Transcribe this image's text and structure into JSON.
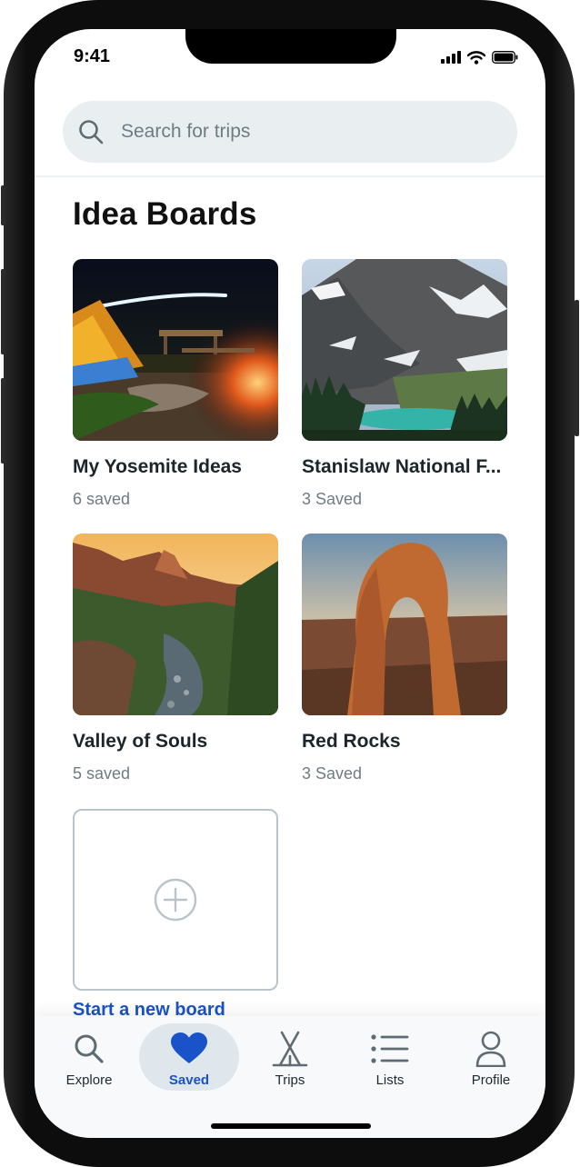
{
  "status_bar": {
    "time": "9:41"
  },
  "search": {
    "placeholder": "Search for trips"
  },
  "page_title": "Idea Boards",
  "boards": [
    {
      "name": "My Yosemite Ideas",
      "count": "6 saved",
      "image": "night-campsite-photo"
    },
    {
      "name": "Stanislaw National F...",
      "count": "3 Saved",
      "image": "mountain-lake-photo"
    },
    {
      "name": "Valley of Souls",
      "count": "5 saved",
      "image": "canyon-river-photo"
    },
    {
      "name": "Red Rocks",
      "count": "3 Saved",
      "image": "sandstone-arch-photo"
    }
  ],
  "new_board": {
    "label": "Start a new board",
    "icon": "plus-circle-icon"
  },
  "tabs": [
    {
      "label": "Explore",
      "icon": "search-icon",
      "active": false
    },
    {
      "label": "Saved",
      "icon": "heart-icon",
      "active": true
    },
    {
      "label": "Trips",
      "icon": "tent-icon",
      "active": false
    },
    {
      "label": "Lists",
      "icon": "list-icon",
      "active": false
    },
    {
      "label": "Profile",
      "icon": "person-icon",
      "active": false
    }
  ],
  "colors": {
    "accent": "#1a52c9",
    "search_bg": "#e9eef1",
    "muted_text": "#6f7c84",
    "active_tab_bg": "#dfe7ec"
  }
}
